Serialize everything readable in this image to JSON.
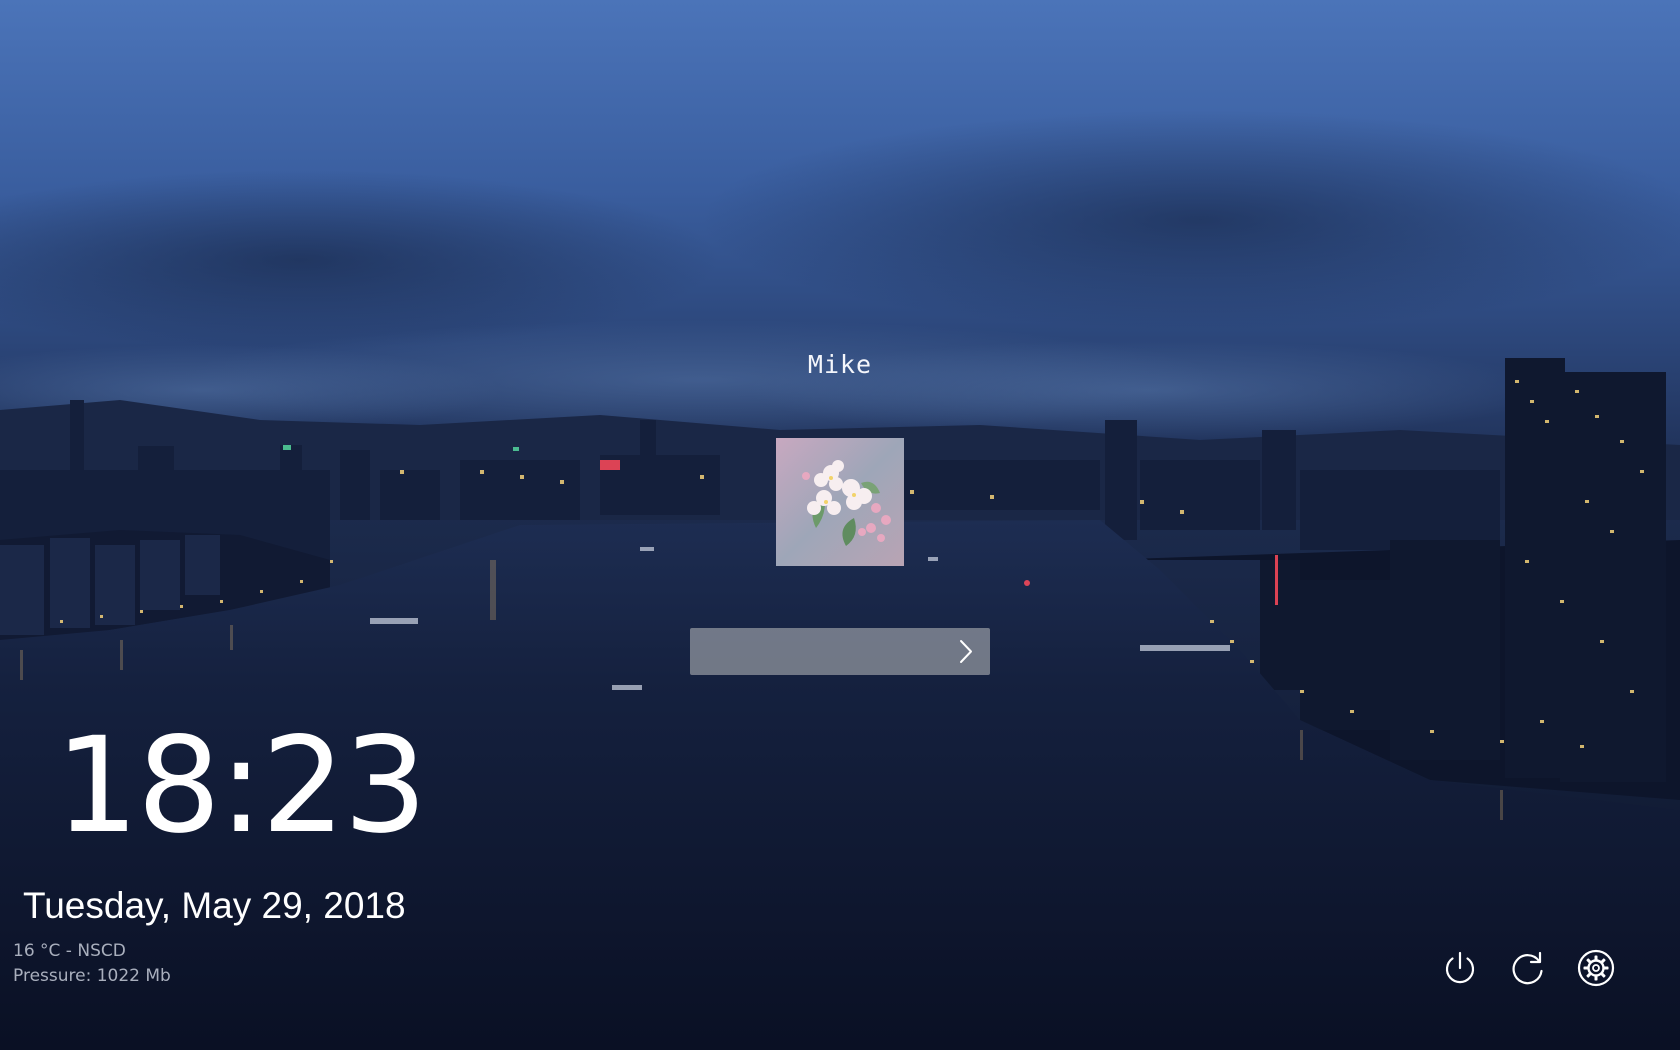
{
  "login": {
    "username": "Mike",
    "password_value": "",
    "password_placeholder": ""
  },
  "clock": {
    "time": "18:23",
    "date": "Tuesday, May 29, 2018"
  },
  "weather": {
    "temperature": "16 °C - NSCD",
    "pressure": "Pressure: 1022 Mb"
  },
  "icons": {
    "submit": "chevron-right-icon",
    "shutdown": "power-icon",
    "reboot": "refresh-icon",
    "settings": "gear-icon"
  },
  "colors": {
    "sky_top": "#4a73b8",
    "water": "#101a35",
    "text": "#ffffff",
    "weather_text": "#a9afbd"
  }
}
